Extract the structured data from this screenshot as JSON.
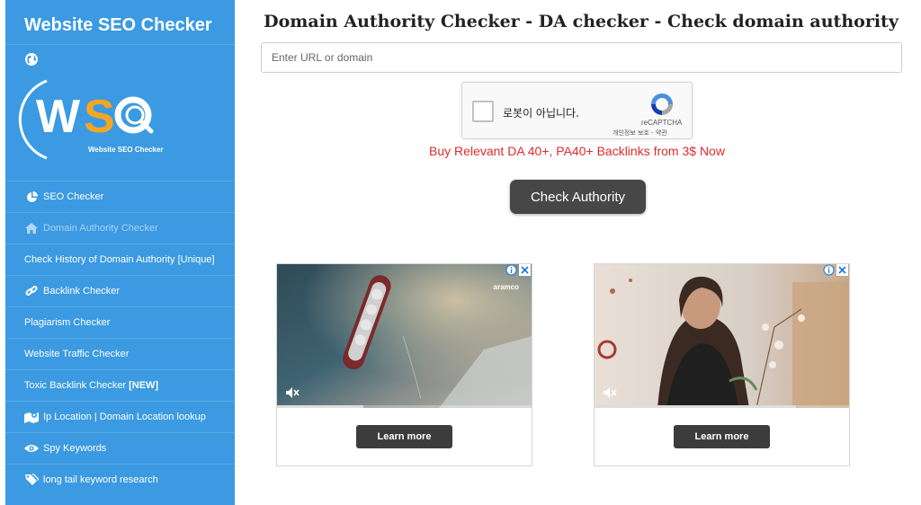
{
  "sidebar": {
    "brand": "Website SEO Checker",
    "logo_caption": "Website SEO Checker",
    "logo_letters": "WSC",
    "items": [
      {
        "label": "SEO Checker",
        "icon": "pie-chart-icon",
        "active": false
      },
      {
        "label": "Domain Authority Checker",
        "icon": "home-icon",
        "active": true
      },
      {
        "label": "Check History of Domain Authority [Unique]",
        "icon": "",
        "active": false
      },
      {
        "label": "Backlink Checker",
        "icon": "link-icon",
        "active": false
      },
      {
        "label": "Plagiarism Checker",
        "icon": "",
        "active": false
      },
      {
        "label": "Website Traffic Checker",
        "icon": "",
        "active": false
      },
      {
        "label": "Toxic Backlink Checker ",
        "badge": "[NEW]",
        "icon": "",
        "active": false
      },
      {
        "label": "Ip Location | Domain Location lookup",
        "icon": "location-icon",
        "active": false
      },
      {
        "label": "Spy Keywords",
        "icon": "eye-icon",
        "active": false
      },
      {
        "label": "long tail keyword research",
        "icon": "tags-icon",
        "active": false
      }
    ]
  },
  "main": {
    "title": "Domain Authority Checker - DA checker - Check domain authority",
    "search_placeholder": "Enter URL or domain",
    "captcha": {
      "label": "로봇이 아닙니다.",
      "brand": "reCAPTCHA",
      "links": "개인정보 보호 - 약관"
    },
    "promo": "Buy Relevant DA 40+, PA40+ Backlinks from 3$ Now",
    "check_button": "Check Authority"
  },
  "ads": [
    {
      "brand": "aramco",
      "button": "Learn more",
      "progress": 0.34
    },
    {
      "button": "Learn more",
      "progress": 0.79
    }
  ],
  "colors": {
    "sidebar": "#3b9ae1",
    "promo": "#e02b2b",
    "button": "#474747",
    "logo_orange": "#f5a623"
  }
}
